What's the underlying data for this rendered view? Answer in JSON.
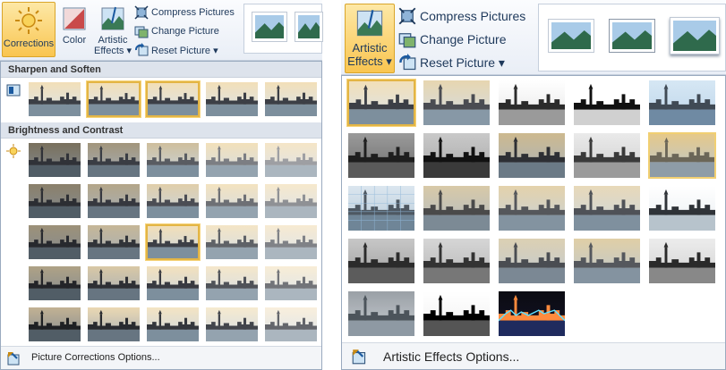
{
  "left": {
    "ribbon": {
      "corrections_label": "Corrections",
      "color_label": "Color",
      "artistic_label_1": "Artistic",
      "artistic_label_2": "Effects ▾",
      "compress_label": "Compress Pictures",
      "change_label": "Change Picture",
      "reset_label": "Reset Picture ▾"
    },
    "sections": {
      "sharpen": "Sharpen and Soften",
      "brightness": "Brightness and Contrast"
    },
    "options_label": "Picture Corrections Options...",
    "options_accesskey_label": "C"
  },
  "right": {
    "ribbon": {
      "artistic_label_1": "Artistic",
      "artistic_label_2": "Effects ▾",
      "compress_label": "Compress Pictures",
      "change_label": "Change Picture",
      "reset_label": "Reset Picture ▾"
    },
    "options_label": "Artistic Effects Options...",
    "options_accesskey_label": "E"
  },
  "colors": {
    "selection_border": "#e3b545",
    "active_button": "#f9c550",
    "header_bg": "#dde3ec",
    "ribbon_text": "#1e395b"
  },
  "icons": [
    "corrections-icon",
    "color-icon",
    "artistic-effects-icon",
    "compress-pictures-icon",
    "change-picture-icon",
    "reset-picture-icon",
    "sharpen-icon",
    "brightness-icon",
    "picture-options-icon"
  ]
}
